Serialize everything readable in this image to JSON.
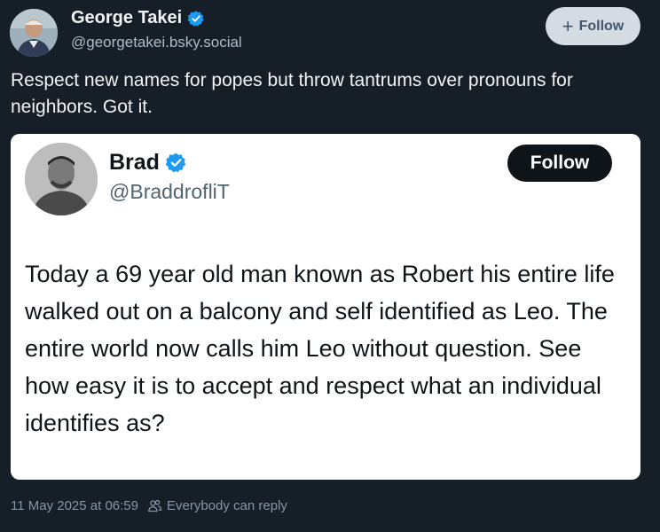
{
  "post": {
    "author": {
      "display_name": "George Takei",
      "handle": "@georgetakei.bsky.social",
      "verified": true
    },
    "follow_button": {
      "label": "Follow",
      "icon": "plus-icon"
    },
    "text": "Respect new names for popes but throw tantrums over pronouns for neighbors. Got it.",
    "embedded_image": {
      "author": {
        "display_name": "Brad",
        "handle": "@BraddrofliT",
        "verified": true
      },
      "follow_label": "Follow",
      "text": "Today a 69 year old man known as Robert his entire life walked out on a balcony and self identified as Leo. The entire world now calls him Leo without question. See how easy it is to accept and respect what an individual identifies as?"
    },
    "footer": {
      "timestamp": "11 May 2025 at 06:59",
      "reply_setting": "Everybody can reply",
      "reply_icon": "people-icon"
    }
  },
  "colors": {
    "background": "#161e27",
    "verified_blue": "#1d9bf0",
    "follow_button_bg": "#d4dbe2",
    "follow_button_text": "#42576c",
    "muted_text": "#8595a6"
  }
}
